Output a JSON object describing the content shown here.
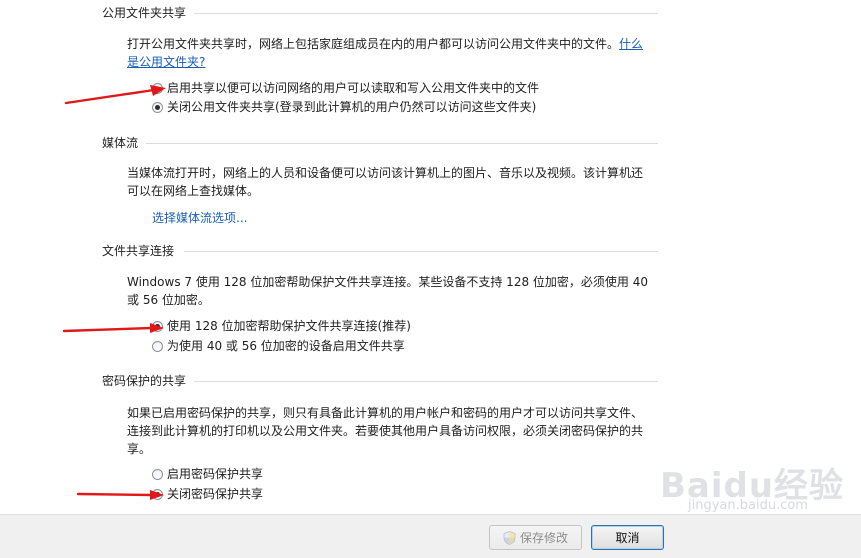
{
  "sections": {
    "public_folder": {
      "title": "公用文件夹共享",
      "desc": "打开公用文件夹共享时，网络上包括家庭组成员在内的用户都可以访问公用文件夹中的文件。",
      "link": "什么是公用文件夹?",
      "options": [
        {
          "label": "启用共享以便可以访问网络的用户可以读取和写入公用文件夹中的文件",
          "selected": false
        },
        {
          "label": "关闭公用文件夹共享(登录到此计算机的用户仍然可以访问这些文件夹)",
          "selected": true
        }
      ]
    },
    "media_stream": {
      "title": "媒体流",
      "desc": "当媒体流打开时，网络上的人员和设备便可以访问该计算机上的图片、音乐以及视频。该计算机还可以在网络上查找媒体。",
      "link": "选择媒体流选项..."
    },
    "file_sharing": {
      "title": "文件共享连接",
      "desc": "Windows 7 使用 128 位加密帮助保护文件共享连接。某些设备不支持 128 位加密，必须使用 40 或 56 位加密。",
      "options": [
        {
          "label": "使用 128 位加密帮助保护文件共享连接(推荐)",
          "selected": true
        },
        {
          "label": "为使用 40 或 56 位加密的设备启用文件共享",
          "selected": false
        }
      ]
    },
    "password": {
      "title": "密码保护的共享",
      "desc": "如果已启用密码保护的共享，则只有具备此计算机的用户帐户和密码的用户才可以访问共享文件、连接到此计算机的打印机以及公用文件夹。若要使其他用户具备访问权限，必须关闭密码保护的共享。",
      "options": [
        {
          "label": "启用密码保护共享",
          "selected": false
        },
        {
          "label": "关闭密码保护共享",
          "selected": true
        }
      ]
    }
  },
  "footer": {
    "save_label": "保存修改",
    "cancel_label": "取消"
  },
  "watermark": {
    "logo": "Baidu经验",
    "url": "jingyan.baidu.com"
  },
  "colors": {
    "link": "#1a5fb4",
    "arrow": "#e01818",
    "rule": "#d9dde2"
  }
}
